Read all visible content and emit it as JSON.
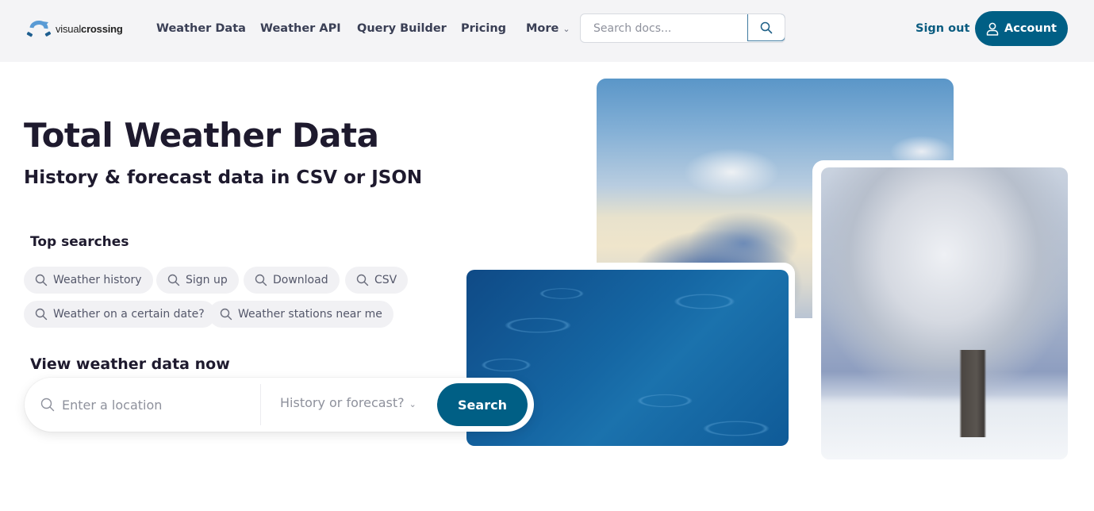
{
  "brand": {
    "logo_light": "visual",
    "logo_bold": "crossing",
    "accent_color": "#005f85"
  },
  "nav": {
    "items": [
      {
        "label": "Weather Data"
      },
      {
        "label": "Weather API"
      },
      {
        "label": "Query Builder"
      },
      {
        "label": "Pricing"
      },
      {
        "label": "More",
        "icon": "chevron-down-icon"
      }
    ],
    "doc_search": {
      "placeholder": "Search docs...",
      "value": "",
      "button_icon": "search-icon"
    },
    "sign_out_label": "Sign out",
    "account_label": "Account",
    "account_icon": "user-icon"
  },
  "hero": {
    "title": "Total Weather Data",
    "subtitle": "History & forecast data in CSV or JSON"
  },
  "top_searches": {
    "heading": "Top searches",
    "chips": [
      {
        "label": "Weather history",
        "icon": "search-icon"
      },
      {
        "label": "Sign up",
        "icon": "search-icon"
      },
      {
        "label": "Download",
        "icon": "search-icon"
      },
      {
        "label": "CSV",
        "icon": "search-icon"
      },
      {
        "label": "Weather on a certain date?",
        "icon": "search-icon"
      },
      {
        "label": "Weather stations near me",
        "icon": "search-icon"
      }
    ]
  },
  "view_now": {
    "heading": "View weather data now",
    "location_placeholder": "Enter a location",
    "location_value": "",
    "mode_select": "History or forecast?",
    "search_label": "Search"
  },
  "images": [
    {
      "subject": "clouds above sky"
    },
    {
      "subject": "raindrops on water"
    },
    {
      "subject": "frosted tree in snow"
    }
  ]
}
